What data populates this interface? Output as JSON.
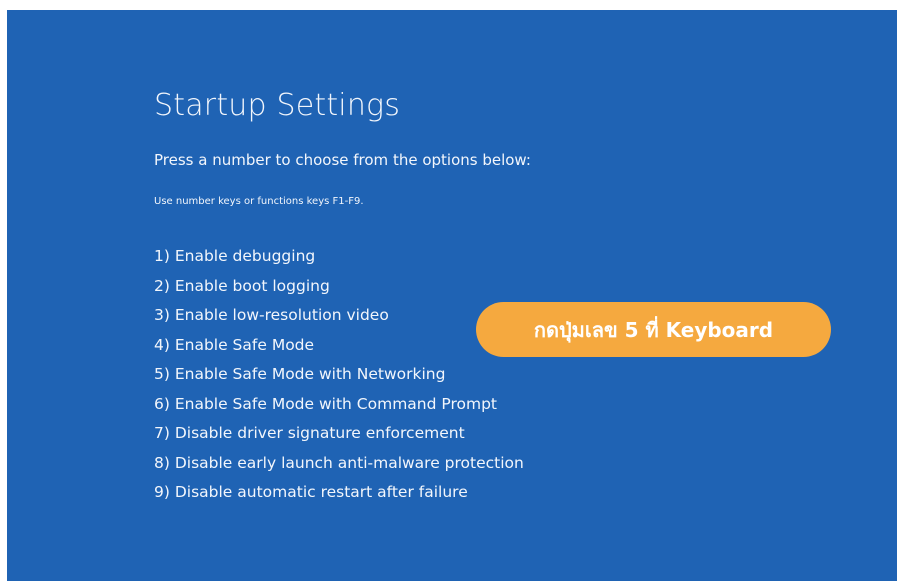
{
  "screen": {
    "title": "Startup Settings",
    "subtitle": "Press a number to choose from the options below:",
    "hint": "Use number keys or functions keys F1-F9.",
    "options": [
      "1) Enable debugging",
      "2) Enable boot logging",
      "3) Enable low-resolution video",
      "4) Enable Safe Mode",
      "5) Enable Safe Mode with Networking",
      "6) Enable Safe Mode with Command Prompt",
      "7) Disable driver signature enforcement",
      "8) Disable early launch anti-malware protection",
      "9) Disable automatic restart after failure"
    ]
  },
  "callout": {
    "text": "กดปุ่มเลข 5 ที่ Keyboard"
  },
  "colors": {
    "background": "#1f63b4",
    "text": "#f2f6fc",
    "callout": "#f5a93f"
  }
}
